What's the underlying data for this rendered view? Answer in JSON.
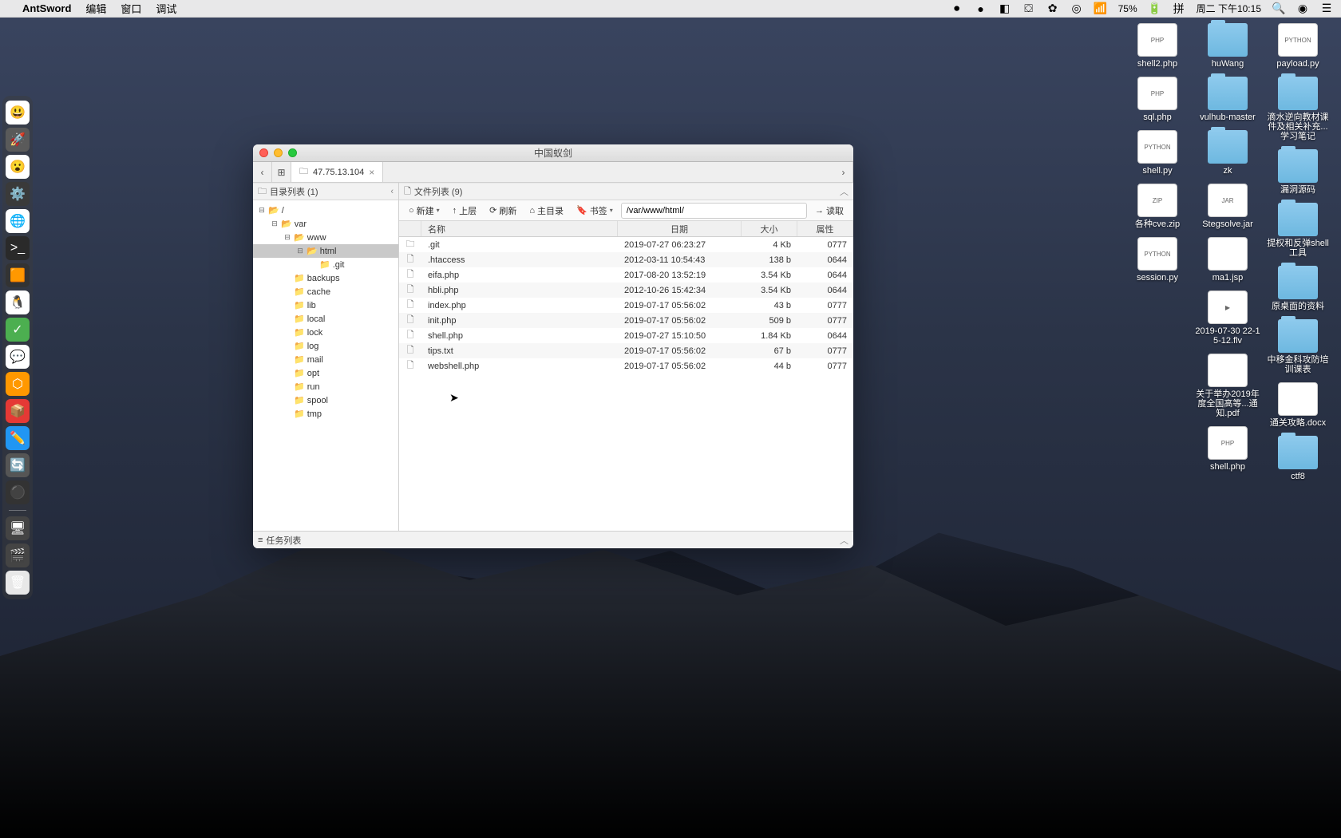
{
  "menubar": {
    "app_name": "AntSword",
    "items": [
      "编辑",
      "窗口",
      "调试"
    ],
    "right": {
      "battery": "75%",
      "clock": "周二 下午10:15"
    }
  },
  "dock_items": [
    {
      "bg": "#fff",
      "emoji": "😃"
    },
    {
      "bg": "#5a5a5a",
      "emoji": "🚀"
    },
    {
      "bg": "#fff",
      "emoji": "😮"
    },
    {
      "bg": "#3a3a3a",
      "emoji": "⚙️"
    },
    {
      "bg": "#fff",
      "emoji": "🌐"
    },
    {
      "bg": "#2a2a2a",
      "emoji": ">_"
    },
    {
      "bg": "#333",
      "emoji": "🟧"
    },
    {
      "bg": "#fff",
      "emoji": "🐧"
    },
    {
      "bg": "#4caf50",
      "emoji": "✓"
    },
    {
      "bg": "#fff",
      "emoji": "💬"
    },
    {
      "bg": "#ff9800",
      "emoji": "⬡"
    },
    {
      "bg": "#e53935",
      "emoji": "📦"
    },
    {
      "bg": "#2196f3",
      "emoji": "✏️"
    },
    {
      "bg": "#555",
      "emoji": "🔄"
    },
    {
      "bg": "#333",
      "emoji": "⚫"
    },
    {
      "bg": "#444",
      "emoji": "🖥"
    },
    {
      "bg": "#444",
      "emoji": "🎬"
    },
    {
      "bg": "#e8e8e8",
      "emoji": "🗑"
    }
  ],
  "desktop": {
    "col1": [
      {
        "type": "file-white",
        "badge": "PHP",
        "label": "shell2.php"
      },
      {
        "type": "file-white",
        "badge": "PHP",
        "label": "sql.php"
      },
      {
        "type": "file-white",
        "badge": "PYTHON",
        "label": "shell.py"
      },
      {
        "type": "file-zip",
        "badge": "ZIP",
        "label": "各种cve.zip"
      },
      {
        "type": "file-white",
        "badge": "PYTHON",
        "label": "session.py"
      }
    ],
    "col2": [
      {
        "type": "folder",
        "badge": "",
        "label": "huWang"
      },
      {
        "type": "folder",
        "badge": "",
        "label": "vulhub-master"
      },
      {
        "type": "folder",
        "badge": "",
        "label": "zk"
      },
      {
        "type": "file-jar",
        "badge": "JAR",
        "label": "Stegsolve.jar"
      },
      {
        "type": "file-white",
        "badge": "",
        "label": "ma1.jsp"
      },
      {
        "type": "file-white",
        "badge": "▶",
        "label": "2019-07-30 22-15-12.flv"
      },
      {
        "type": "file-white",
        "badge": "",
        "label": "关于举办2019年度全国高等...通知.pdf"
      },
      {
        "type": "file-white",
        "badge": "PHP",
        "label": "shell.php"
      }
    ],
    "col3": [
      {
        "type": "file-white",
        "badge": "PYTHON",
        "label": "payload.py"
      },
      {
        "type": "folder",
        "badge": "",
        "label": "滴水逆向教材课件及相关补充...学习笔记"
      },
      {
        "type": "folder",
        "badge": "",
        "label": "漏洞源码"
      },
      {
        "type": "folder",
        "badge": "",
        "label": "提权和反弹shell工具"
      },
      {
        "type": "folder",
        "badge": "",
        "label": "原桌面的资料"
      },
      {
        "type": "folder",
        "badge": "",
        "label": "中移金科攻防培训课表"
      },
      {
        "type": "file-white",
        "badge": "",
        "label": "通关攻略.docx"
      },
      {
        "type": "folder",
        "badge": "",
        "label": "ctf8"
      }
    ]
  },
  "window": {
    "title": "中国蚁剑",
    "tab_label": "47.75.13.104",
    "dir_panel_title": "目录列表 (1)",
    "file_panel_title": "文件列表 (9)",
    "task_panel_title": "任务列表",
    "toolbar": {
      "new": "新建",
      "up": "上层",
      "refresh": "刷新",
      "home": "主目录",
      "bookmark": "书签",
      "read": "读取",
      "path": "/var/www/html/"
    },
    "columns": {
      "name": "名称",
      "date": "日期",
      "size": "大小",
      "attr": "属性"
    },
    "tree": [
      {
        "depth": 0,
        "exp": "⊟",
        "open": true,
        "name": "/"
      },
      {
        "depth": 1,
        "exp": "⊟",
        "open": true,
        "name": "var"
      },
      {
        "depth": 2,
        "exp": "⊟",
        "open": true,
        "name": "www"
      },
      {
        "depth": 3,
        "exp": "⊟",
        "open": true,
        "name": "html",
        "selected": true
      },
      {
        "depth": 4,
        "exp": "",
        "open": false,
        "name": ".git"
      },
      {
        "depth": 2,
        "exp": "",
        "open": false,
        "name": "backups"
      },
      {
        "depth": 2,
        "exp": "",
        "open": false,
        "name": "cache"
      },
      {
        "depth": 2,
        "exp": "",
        "open": false,
        "name": "lib"
      },
      {
        "depth": 2,
        "exp": "",
        "open": false,
        "name": "local"
      },
      {
        "depth": 2,
        "exp": "",
        "open": false,
        "name": "lock"
      },
      {
        "depth": 2,
        "exp": "",
        "open": false,
        "name": "log"
      },
      {
        "depth": 2,
        "exp": "",
        "open": false,
        "name": "mail"
      },
      {
        "depth": 2,
        "exp": "",
        "open": false,
        "name": "opt"
      },
      {
        "depth": 2,
        "exp": "",
        "open": false,
        "name": "run"
      },
      {
        "depth": 2,
        "exp": "",
        "open": false,
        "name": "spool"
      },
      {
        "depth": 2,
        "exp": "",
        "open": false,
        "name": "tmp"
      }
    ],
    "files": [
      {
        "icon": "📁",
        "name": ".git",
        "date": "2019-07-27 06:23:27",
        "size": "4 Kb",
        "attr": "0777"
      },
      {
        "icon": "📄",
        "name": ".htaccess",
        "date": "2012-03-11 10:54:43",
        "size": "138 b",
        "attr": "0644"
      },
      {
        "icon": "📄",
        "name": "eifa.php",
        "date": "2017-08-20 13:52:19",
        "size": "3.54 Kb",
        "attr": "0644"
      },
      {
        "icon": "📄",
        "name": "hbli.php",
        "date": "2012-10-26 15:42:34",
        "size": "3.54 Kb",
        "attr": "0644"
      },
      {
        "icon": "📄",
        "name": "index.php",
        "date": "2019-07-17 05:56:02",
        "size": "43 b",
        "attr": "0777"
      },
      {
        "icon": "📄",
        "name": "init.php",
        "date": "2019-07-17 05:56:02",
        "size": "509 b",
        "attr": "0777"
      },
      {
        "icon": "📄",
        "name": "shell.php",
        "date": "2019-07-27 15:10:50",
        "size": "1.84 Kb",
        "attr": "0644"
      },
      {
        "icon": "📄",
        "name": "tips.txt",
        "date": "2019-07-17 05:56:02",
        "size": "67 b",
        "attr": "0777"
      },
      {
        "icon": "📄",
        "name": "webshell.php",
        "date": "2019-07-17 05:56:02",
        "size": "44 b",
        "attr": "0777"
      }
    ]
  }
}
